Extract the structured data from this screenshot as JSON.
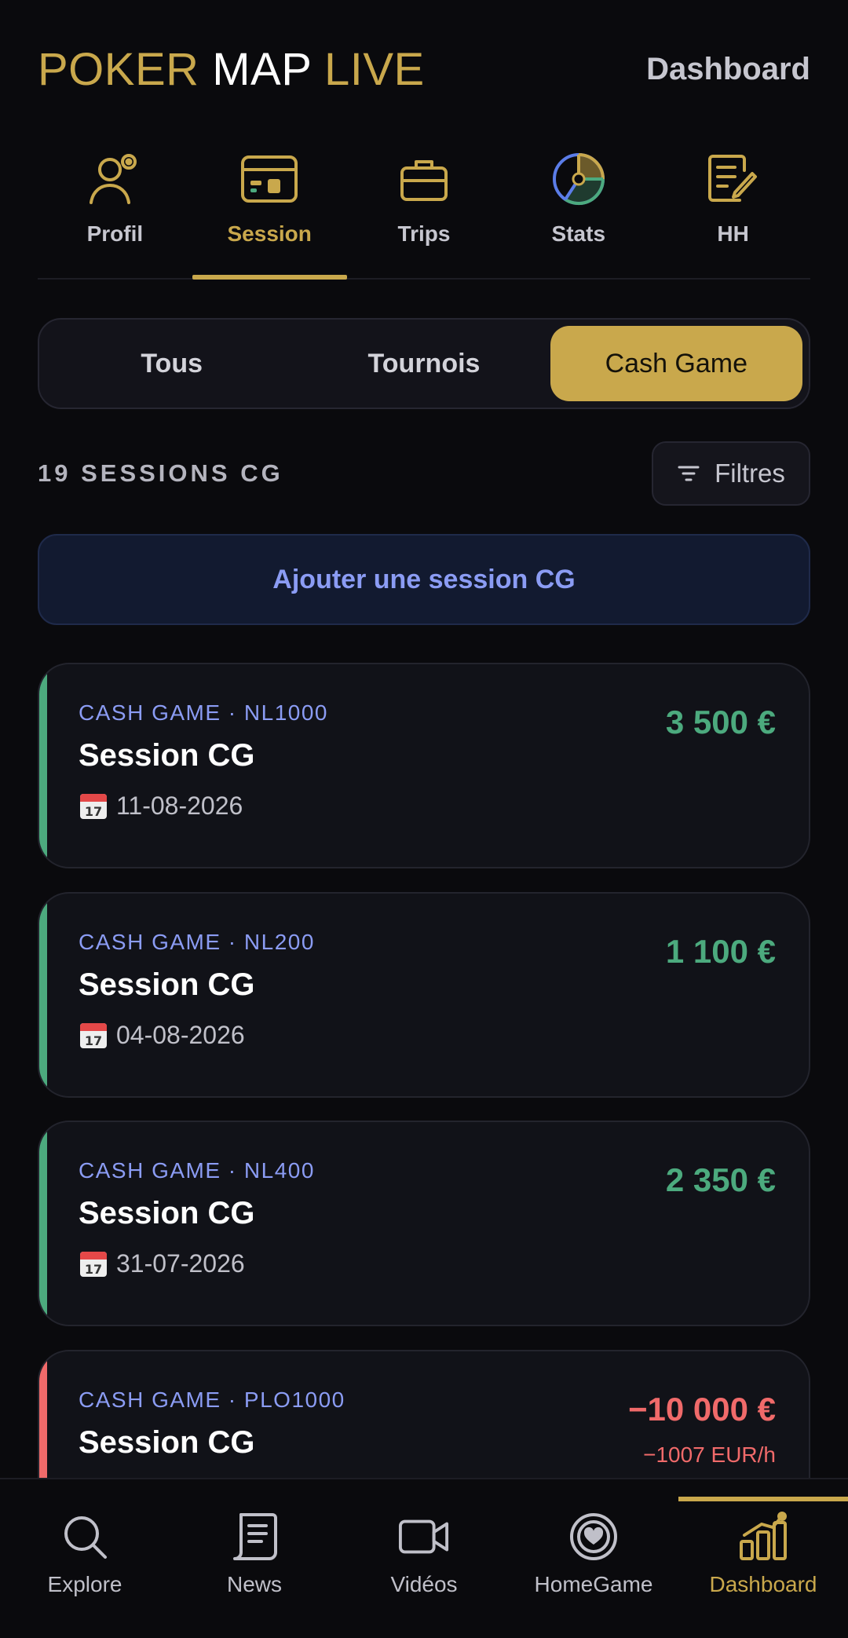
{
  "header": {
    "logo": {
      "part1": "POKER",
      "part2": "MAP",
      "part3": "LIVE"
    },
    "link": "Dashboard"
  },
  "topnav": [
    {
      "label": "Profil",
      "icon": "user-icon",
      "active": false
    },
    {
      "label": "Session",
      "icon": "card-icon",
      "active": true
    },
    {
      "label": "Trips",
      "icon": "briefcase-icon",
      "active": false
    },
    {
      "label": "Stats",
      "icon": "pie-chart-icon",
      "active": false
    },
    {
      "label": "HH",
      "icon": "notes-edit-icon",
      "active": false
    }
  ],
  "segment": {
    "options": [
      "Tous",
      "Tournois",
      "Cash Game"
    ],
    "selected": "Cash Game"
  },
  "list": {
    "count": "19 SESSIONS CG",
    "filter_label": "Filtres",
    "add_label": "Ajouter une session CG"
  },
  "sessions": [
    {
      "tag": "CASH GAME · NL1000",
      "title": "Session CG",
      "date": "11-08-2026",
      "amount": "3 500 €",
      "rate": "",
      "status": "positive"
    },
    {
      "tag": "CASH GAME · NL200",
      "title": "Session CG",
      "date": "04-08-2026",
      "amount": "1 100 €",
      "rate": "",
      "status": "positive"
    },
    {
      "tag": "CASH GAME · NL400",
      "title": "Session CG",
      "date": "31-07-2026",
      "amount": "2 350 €",
      "rate": "",
      "status": "positive"
    },
    {
      "tag": "CASH GAME · PLO1000",
      "title": "Session CG",
      "date": "",
      "amount": "−10 000 €",
      "rate": "−1007 EUR/h",
      "status": "negative"
    }
  ],
  "bottomnav": [
    {
      "label": "Explore",
      "icon": "search-icon",
      "active": false
    },
    {
      "label": "News",
      "icon": "news-icon",
      "active": false
    },
    {
      "label": "Vidéos",
      "icon": "video-icon",
      "active": false
    },
    {
      "label": "HomeGame",
      "icon": "heart-chip-icon",
      "active": false
    },
    {
      "label": "Dashboard",
      "icon": "bar-chart-icon",
      "active": true
    }
  ],
  "colors": {
    "gold": "#c9a84c",
    "green": "#4caa7e",
    "red": "#f06a6a",
    "blue": "#8b9cf4",
    "background": "#0a0a0d"
  }
}
